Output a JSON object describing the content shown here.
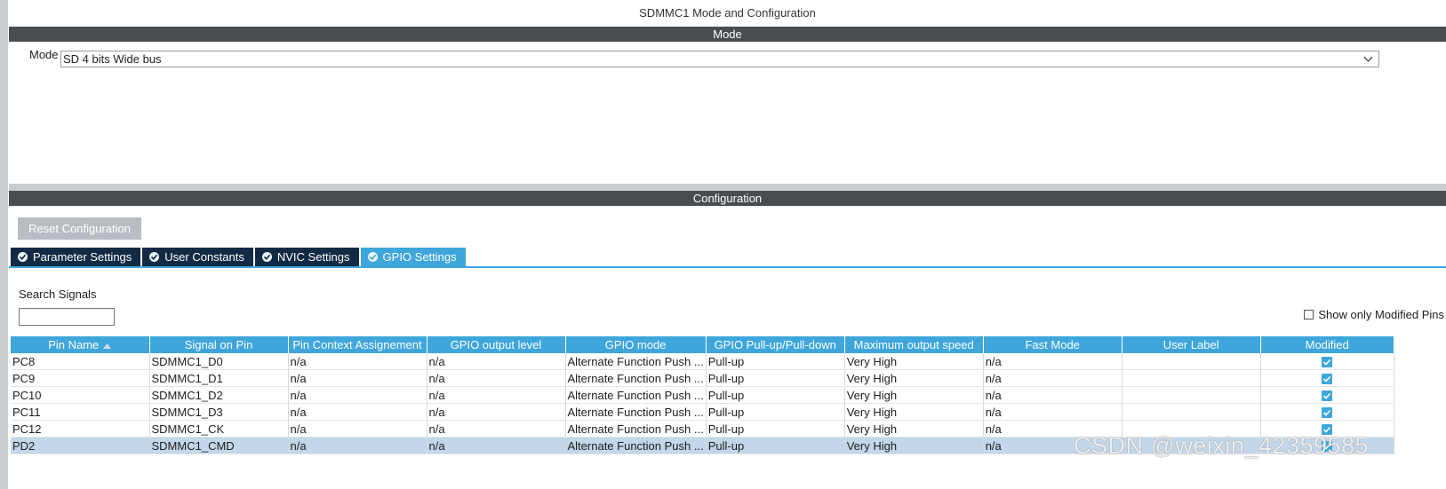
{
  "window": {
    "title": "SDMMC1 Mode and Configuration"
  },
  "mode_section": {
    "header": "Mode",
    "mode_label": "Mode",
    "mode_value": "SD 4 bits Wide bus"
  },
  "config_section": {
    "header": "Configuration",
    "reset_label": "Reset Configuration",
    "tabs": [
      {
        "label": "Parameter Settings",
        "active": false
      },
      {
        "label": "User Constants",
        "active": false
      },
      {
        "label": "NVIC Settings",
        "active": false
      },
      {
        "label": "GPIO Settings",
        "active": true
      }
    ]
  },
  "search": {
    "label": "Search Signals",
    "value": "",
    "placeholder": ""
  },
  "show_modified": {
    "label": "Show only Modified Pins",
    "checked": false
  },
  "table": {
    "columns": [
      "Pin Name",
      "Signal on Pin",
      "Pin Context Assignement",
      "GPIO output level",
      "GPIO mode",
      "GPIO Pull-up/Pull-down",
      "Maximum output speed",
      "Fast Mode",
      "User Label",
      "Modified"
    ],
    "rows": [
      {
        "pin": "PC8",
        "signal": "SDMMC1_D0",
        "context": "n/a",
        "output_level": "n/a",
        "mode": "Alternate Function Push ...",
        "pull": "Pull-up",
        "speed": "Very High",
        "fast": "n/a",
        "user_label": "",
        "modified": true,
        "selected": false
      },
      {
        "pin": "PC9",
        "signal": "SDMMC1_D1",
        "context": "n/a",
        "output_level": "n/a",
        "mode": "Alternate Function Push ...",
        "pull": "Pull-up",
        "speed": "Very High",
        "fast": "n/a",
        "user_label": "",
        "modified": true,
        "selected": false
      },
      {
        "pin": "PC10",
        "signal": "SDMMC1_D2",
        "context": "n/a",
        "output_level": "n/a",
        "mode": "Alternate Function Push ...",
        "pull": "Pull-up",
        "speed": "Very High",
        "fast": "n/a",
        "user_label": "",
        "modified": true,
        "selected": false
      },
      {
        "pin": "PC11",
        "signal": "SDMMC1_D3",
        "context": "n/a",
        "output_level": "n/a",
        "mode": "Alternate Function Push ...",
        "pull": "Pull-up",
        "speed": "Very High",
        "fast": "n/a",
        "user_label": "",
        "modified": true,
        "selected": false
      },
      {
        "pin": "PC12",
        "signal": "SDMMC1_CK",
        "context": "n/a",
        "output_level": "n/a",
        "mode": "Alternate Function Push ...",
        "pull": "Pull-up",
        "speed": "Very High",
        "fast": "n/a",
        "user_label": "",
        "modified": true,
        "selected": false
      },
      {
        "pin": "PD2",
        "signal": "SDMMC1_CMD",
        "context": "n/a",
        "output_level": "n/a",
        "mode": "Alternate Function Push ...",
        "pull": "Pull-up",
        "speed": "Very High",
        "fast": "n/a",
        "user_label": "",
        "modified": true,
        "selected": true
      }
    ]
  },
  "watermark": "CSDN @weixin_42359585",
  "colors": {
    "header_bar": "#4a4d50",
    "accent_blue": "#3ea6db",
    "tab_dark": "#132a44",
    "selected_row": "#c3d6ea",
    "button_disabled": "#b7bdc2"
  },
  "icons": {
    "tab_status": "check-circle-icon",
    "sort": "sort-ascending-icon",
    "dropdown": "chevron-down-icon",
    "modified": "checkbox-checked-icon"
  }
}
